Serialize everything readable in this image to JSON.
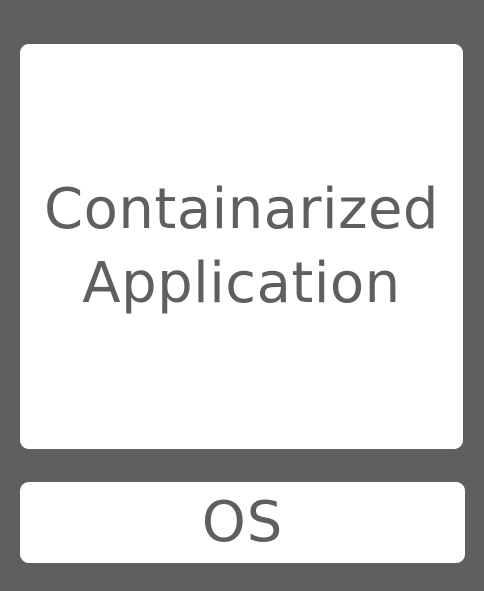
{
  "diagram": {
    "application_box": {
      "line1": "Containarized",
      "line2": "Application"
    },
    "os_box": {
      "label": "OS"
    }
  },
  "colors": {
    "frame": "#5f5f5f",
    "box_fill": "#ffffff",
    "text": "#5f5f5f"
  }
}
